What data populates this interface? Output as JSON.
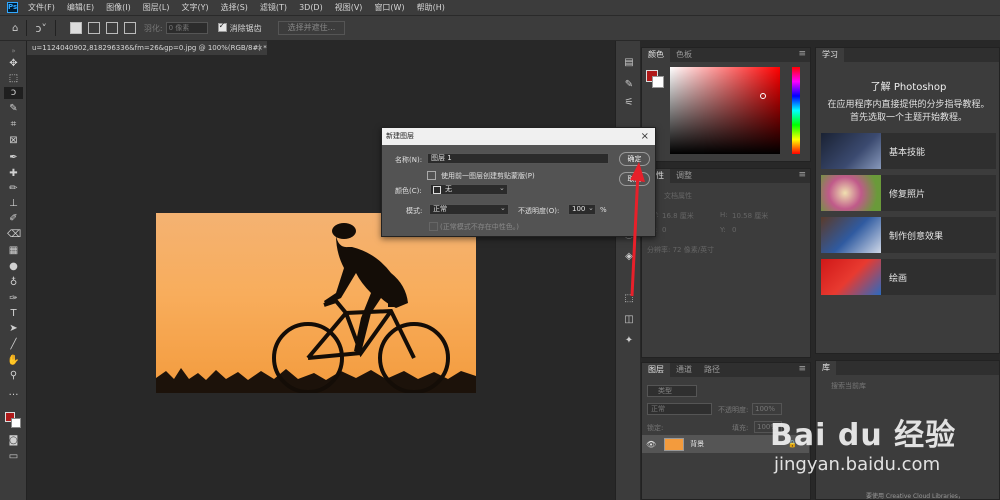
{
  "app": {
    "logo": "Ps"
  },
  "menu": [
    "文件(F)",
    "编辑(E)",
    "图像(I)",
    "图层(L)",
    "文字(Y)",
    "选择(S)",
    "滤镜(T)",
    "3D(D)",
    "视图(V)",
    "窗口(W)",
    "帮助(H)"
  ],
  "options": {
    "feather_label": "羽化:",
    "feather_value": "0 像素",
    "antialias_label": "消除锯齿",
    "select_mask_button": "选择并遮住..."
  },
  "document": {
    "tab_title": "u=1124040902,818296336&fm=26&gp=0.jpg @ 100%(RGB/8#) *",
    "close_glyph": "×"
  },
  "color_panel": {
    "tabs": [
      "颜色",
      "色板"
    ],
    "fg_color": "#b01a1a",
    "bg_color": "#ffffff"
  },
  "properties_panel": {
    "tabs": [
      "属性",
      "调整"
    ],
    "doc_props": "文档属性",
    "w_label": "W:",
    "w_value": "16.8 厘米",
    "h_label": "H:",
    "h_value": "10.58 厘米",
    "x_label": "X:",
    "x_value": "0",
    "y_label": "Y:",
    "y_value": "0",
    "resolution": "分辨率: 72 像素/英寸"
  },
  "learn_panel": {
    "tab": "学习",
    "heading": "了解 Photoshop",
    "sub1": "在应用程序内直接提供的分步指导教程。",
    "sub2": "首先选取一个主题开始教程。",
    "cards": [
      {
        "label": "基本技能"
      },
      {
        "label": "修复照片"
      },
      {
        "label": "制作创意效果"
      },
      {
        "label": "绘画"
      }
    ]
  },
  "dialog": {
    "title": "新建图层",
    "name_label": "名称(N):",
    "name_value": "图层 1",
    "clip_label": "使用前一图层创建剪贴蒙版(P)",
    "color_label": "颜色(C):",
    "color_value": "无",
    "mode_label": "模式:",
    "mode_value": "正常",
    "opacity_label": "不透明度(O):",
    "opacity_value": "100",
    "opacity_unit": "%",
    "neutral_label": "(正常模式不存在中性色。)",
    "ok_button": "确定",
    "cancel_button": "取消"
  },
  "layers_panel": {
    "tabs": [
      "图层",
      "通道",
      "路径"
    ],
    "filter_label": "类型",
    "blend_mode": "正常",
    "opacity_label": "不透明度:",
    "opacity_value": "100%",
    "lock_label": "锁定:",
    "fill_label": "填充:",
    "fill_value": "100%",
    "layer_name": "背景"
  },
  "libraries_panel": {
    "tab": "库",
    "search_placeholder": "搜索当前库",
    "footer": "要使用 Creative Cloud Libraries，"
  },
  "watermark": {
    "brand": "Bai du 经验",
    "url": "jingyan.baidu.com"
  }
}
